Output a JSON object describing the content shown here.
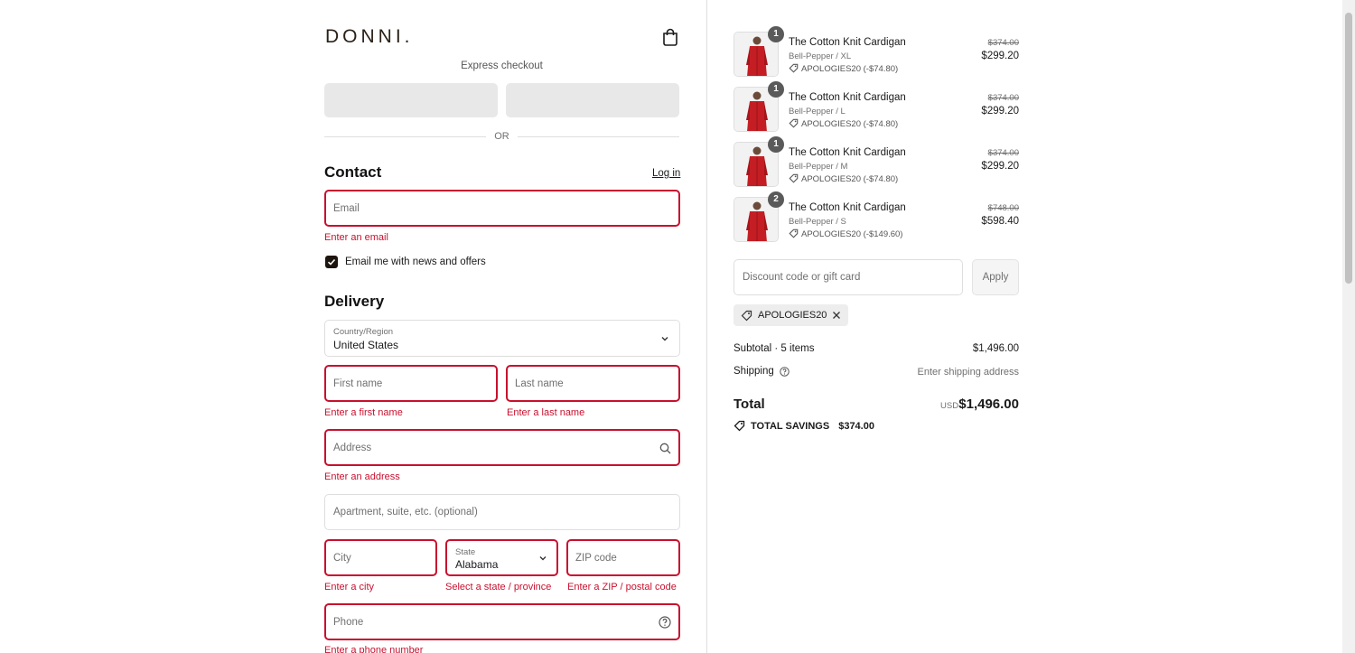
{
  "brand": {
    "logo_text": "DONNI."
  },
  "express": {
    "label": "Express checkout",
    "or_text": "OR"
  },
  "contact": {
    "title": "Contact",
    "login_label": "Log in",
    "email_placeholder": "Email",
    "email_error": "Enter an email",
    "newsletter_label": "Email me with news and offers",
    "newsletter_checked": true
  },
  "delivery": {
    "title": "Delivery",
    "country_label": "Country/Region",
    "country_value": "United States",
    "first_name_placeholder": "First name",
    "first_name_error": "Enter a first name",
    "last_name_placeholder": "Last name",
    "last_name_error": "Enter a last name",
    "address_placeholder": "Address",
    "address_error": "Enter an address",
    "apartment_placeholder": "Apartment, suite, etc. (optional)",
    "city_placeholder": "City",
    "city_error": "Enter a city",
    "state_label": "State",
    "state_value": "Alabama",
    "state_error": "Select a state / province",
    "zip_placeholder": "ZIP code",
    "zip_error": "Enter a ZIP / postal code",
    "phone_placeholder": "Phone",
    "phone_error": "Enter a phone number"
  },
  "order": {
    "items": [
      {
        "qty": "1",
        "name": "The Cotton Knit Cardigan",
        "variant": "Bell-Pepper / XL",
        "discount": "APOLOGIES20 (-$74.80)",
        "original": "$374.00",
        "price": "$299.20"
      },
      {
        "qty": "1",
        "name": "The Cotton Knit Cardigan",
        "variant": "Bell-Pepper / L",
        "discount": "APOLOGIES20 (-$74.80)",
        "original": "$374.00",
        "price": "$299.20"
      },
      {
        "qty": "1",
        "name": "The Cotton Knit Cardigan",
        "variant": "Bell-Pepper / M",
        "discount": "APOLOGIES20 (-$74.80)",
        "original": "$374.00",
        "price": "$299.20"
      },
      {
        "qty": "2",
        "name": "The Cotton Knit Cardigan",
        "variant": "Bell-Pepper / S",
        "discount": "APOLOGIES20 (-$149.60)",
        "original": "$748.00",
        "price": "$598.40"
      }
    ],
    "discount_placeholder": "Discount code or gift card",
    "apply_label": "Apply",
    "applied_code": "APOLOGIES20",
    "subtotal_label": "Subtotal · 5 items",
    "subtotal_value": "$1,496.00",
    "shipping_label": "Shipping",
    "shipping_value": "Enter shipping address",
    "total_label": "Total",
    "total_currency": "USD",
    "total_value": "$1,496.00",
    "savings_label": "TOTAL SAVINGS",
    "savings_value": "$374.00"
  },
  "colors": {
    "error": "#c8102e",
    "dark": "#1d140e",
    "product": "#c41e24"
  }
}
